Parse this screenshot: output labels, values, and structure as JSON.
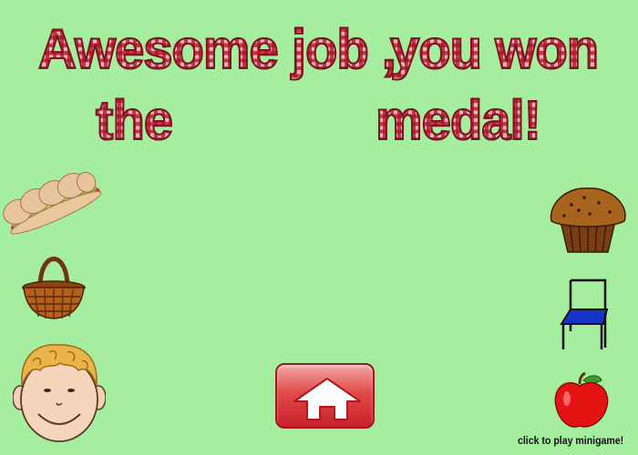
{
  "title": {
    "line1_part1": "Awesome job ,",
    "line1_part2": "you won",
    "line2_part1": "the",
    "line2_part2": "medal!"
  },
  "minigame": {
    "caption": "click to play minigame!"
  },
  "icons": {
    "left": [
      "sandwich-icon",
      "basket-icon",
      "boy-face-icon"
    ],
    "right": [
      "muffin-icon",
      "chair-icon",
      "apple-icon"
    ],
    "center": "home-icon"
  },
  "colors": {
    "background": "#a6ee9f",
    "title_red": "#c8283a",
    "button_red": "#e04a4a"
  }
}
